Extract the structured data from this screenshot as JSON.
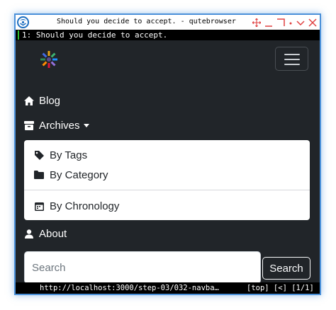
{
  "window": {
    "title": "Should you decide to accept. - qutebrowser",
    "app_icon": "qutebrowser-icon"
  },
  "tab": {
    "label": "1: Should you decide to accept."
  },
  "navbar": {
    "brand_icon": "site-logo-icon",
    "toggler_icon": "hamburger-menu-icon",
    "links": {
      "blog": "Blog",
      "archives": "Archives",
      "about": "About"
    },
    "dropdown": {
      "by_tags": "By Tags",
      "by_category": "By Category",
      "by_chronology": "By Chronology"
    },
    "search": {
      "placeholder": "Search",
      "button": "Search"
    }
  },
  "status": {
    "url": "http://localhost:3000/step-03/032-navba…",
    "position": "[top] [<] [1/1]"
  },
  "colors": {
    "page_bg": "#212529",
    "accent_border": "#4a90d9",
    "tab_indicator": "#2dbd2d",
    "window_control_red": "#e04040"
  }
}
